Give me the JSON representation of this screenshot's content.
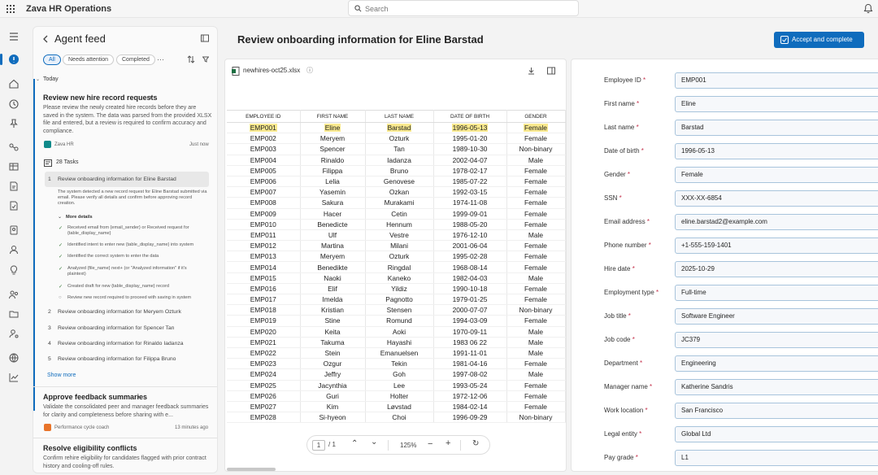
{
  "app": {
    "title": "Zava HR Operations",
    "search_placeholder": "Search"
  },
  "agent_feed": {
    "title": "Agent feed",
    "filters": [
      "All",
      "Needs attention",
      "Completed"
    ],
    "today": "Today",
    "card1": {
      "title": "Review new hire record requests",
      "desc": "Please review the newly created hire records before they are saved in the system. The data was parsed from the provided XLSX file and entered, but a review is required to confirm accuracy and compliance.",
      "source": "Zava HR",
      "time": "Just now"
    },
    "tasks_count": "28 Tasks",
    "tasks": [
      {
        "n": "1",
        "label": "Review onboarding information for Eline Barstad"
      },
      {
        "n": "2",
        "label": "Review onboarding information for Meryem Ozturk"
      },
      {
        "n": "3",
        "label": "Review onboarding information for Spencer Tan"
      },
      {
        "n": "4",
        "label": "Review onboarding information for Rinaldo Iadanza"
      },
      {
        "n": "5",
        "label": "Review onboarding information for Filippa Bruno"
      }
    ],
    "task_detail": "The system detected a new record request for Eline Barstad submitted via email. Please verify all details and confirm before approving record creation.",
    "more_details": "More details",
    "steps": [
      "Received email from {email_sender} or Received request for {table_display_name}",
      "Identified intent to enter new {table_display_name} into system",
      "Identified the correct system to enter the data",
      "Analyzed {file_name} next+ (or \"Analyzed information\" if it's plaintext)",
      "Created draft for new {table_display_name} record",
      "Review new record required to proceed with saving in system"
    ],
    "show_more": "Show more",
    "card2": {
      "title": "Approve feedback summaries",
      "desc": "Validate the consolidated peer and manager feedback summaries for clarity and completeness before sharing with e...",
      "source": "Performance cycle coach",
      "time": "13 minutes ago"
    },
    "card3": {
      "title": "Resolve eligibility conflicts",
      "desc": "Confirm rehire eligibility for candidates flagged with prior contract history and cooling-off rules."
    }
  },
  "main": {
    "title": "Review onboarding information for Eline Barstad",
    "accept_label": "Accept and complete"
  },
  "sheet": {
    "file": "newhires-oct25.xlsx",
    "columns": [
      "EMPLOYEE ID",
      "FIRST NAME",
      "LAST NAME",
      "DATE OF BIRTH",
      "GENDER"
    ],
    "rows": [
      [
        "EMP001",
        "Eline",
        "Barstad",
        "1996-05-13",
        "Female"
      ],
      [
        "EMP002",
        "Meryem",
        "Ozturk",
        "1995-01-20",
        "Female"
      ],
      [
        "EMP003",
        "Spencer",
        "Tan",
        "1989-10-30",
        "Non-binary"
      ],
      [
        "EMP004",
        "Rinaldo",
        "Iadanza",
        "2002-04-07",
        "Male"
      ],
      [
        "EMP005",
        "Filippa",
        "Bruno",
        "1978-02-17",
        "Female"
      ],
      [
        "EMP006",
        "Lelia",
        "Genovese",
        "1985-07-22",
        "Female"
      ],
      [
        "EMP007",
        "Yasemin",
        "Ozkan",
        "1992-03-15",
        "Female"
      ],
      [
        "EMP008",
        "Sakura",
        "Murakami",
        "1974-11-08",
        "Female"
      ],
      [
        "EMP009",
        "Hacer",
        "Cetin",
        "1999-09-01",
        "Female"
      ],
      [
        "EMP010",
        "Benedicte",
        "Hennum",
        "1988-05-20",
        "Female"
      ],
      [
        "EMP011",
        "Ulf",
        "Vestre",
        "1976-12-10",
        "Male"
      ],
      [
        "EMP012",
        "Martina",
        "Milani",
        "2001-06-04",
        "Female"
      ],
      [
        "EMP013",
        "Meryem",
        "Ozturk",
        "1995-02-28",
        "Female"
      ],
      [
        "EMP014",
        "Benedikte",
        "Ringdal",
        "1968-08-14",
        "Female"
      ],
      [
        "EMP015",
        "Naoki",
        "Kaneko",
        "1982-04-03",
        "Male"
      ],
      [
        "EMP016",
        "Elif",
        "Yildiz",
        "1990-10-18",
        "Female"
      ],
      [
        "EMP017",
        "Imelda",
        "Pagnotto",
        "1979-01-25",
        "Female"
      ],
      [
        "EMP018",
        "Kristian",
        "Stensen",
        "2000-07-07",
        "Non-binary"
      ],
      [
        "EMP019",
        "Stine",
        "Romund",
        "1994-03-09",
        "Female"
      ],
      [
        "EMP020",
        "Keita",
        "Aoki",
        "1970-09-11",
        "Male"
      ],
      [
        "EMP021",
        "Takuma",
        "Hayashi",
        "1983 06 22",
        "Male"
      ],
      [
        "EMP022",
        "Stein",
        "Emanuelsen",
        "1991-11-01",
        "Male"
      ],
      [
        "EMP023",
        "Ozgur",
        "Tekin",
        "1981-04-16",
        "Female"
      ],
      [
        "EMP024",
        "Jeffry",
        "Goh",
        "1997-08-02",
        "Male"
      ],
      [
        "EMP025",
        "Jacynthia",
        "Lee",
        "1993-05-24",
        "Female"
      ],
      [
        "EMP026",
        "Guri",
        "Holter",
        "1972-12-06",
        "Female"
      ],
      [
        "EMP027",
        "Kim",
        "Løvstad",
        "1984-02-14",
        "Female"
      ],
      [
        "EMP028",
        "Si-hyeon",
        "Choi",
        "1996-09-29",
        "Non-binary"
      ]
    ],
    "page": "1",
    "page_total": "/ 1",
    "zoom": "125%"
  },
  "form": {
    "fields": [
      {
        "label": "Employee ID",
        "value": "EMP001"
      },
      {
        "label": "First name",
        "value": "Eline"
      },
      {
        "label": "Last name",
        "value": "Barstad"
      },
      {
        "label": "Date of birth",
        "value": "1996-05-13"
      },
      {
        "label": "Gender",
        "value": "Female"
      },
      {
        "label": "SSN",
        "value": "XXX-XX-6854"
      },
      {
        "label": "Email address",
        "value": "eline.barstad2@example.com"
      },
      {
        "label": "Phone number",
        "value": "+1-555-159-1401"
      },
      {
        "label": "Hire date",
        "value": "2025-10-29"
      },
      {
        "label": "Employment type",
        "value": "Full-time"
      },
      {
        "label": "Job title",
        "value": "Software Engineer"
      },
      {
        "label": "Job code",
        "value": "JC379"
      },
      {
        "label": "Department",
        "value": "Engineering"
      },
      {
        "label": "Manager name",
        "value": "Katherine Sandris"
      },
      {
        "label": "Work location",
        "value": "San Francisco"
      },
      {
        "label": "Legal entity",
        "value": "Global Ltd"
      },
      {
        "label": "Pay grade",
        "value": "L1"
      }
    ]
  },
  "colors": {
    "accent": "#0f6cbd",
    "highlight": "#f9e98f"
  }
}
